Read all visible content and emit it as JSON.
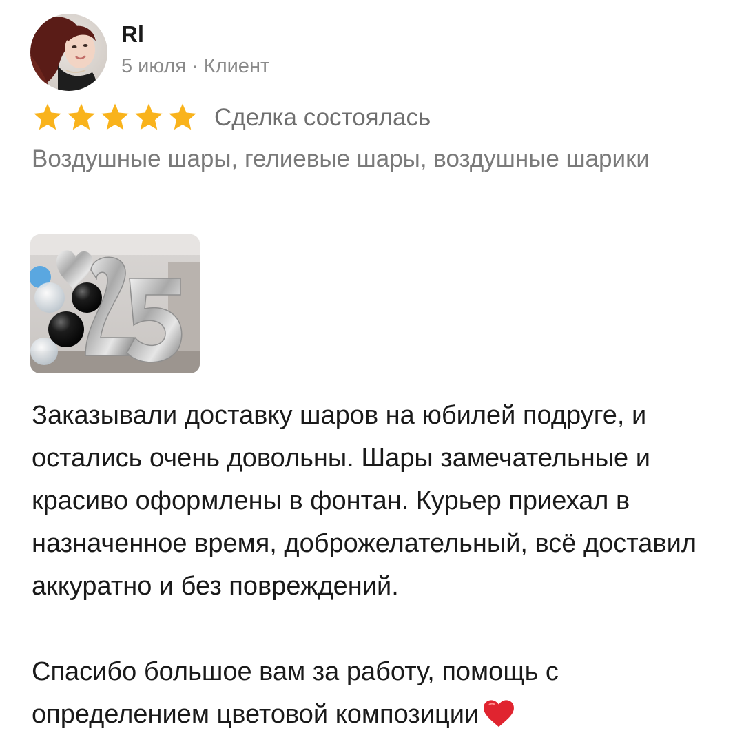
{
  "review": {
    "author": {
      "name": "Rl",
      "date": "5 июля",
      "separator": "·",
      "role": "Клиент"
    },
    "rating": {
      "stars": 5,
      "max": 5,
      "star_color": "#f9b31c"
    },
    "deal_status": "Сделка состоялась",
    "categories": "Воздушные шары, гелиевые шары, воздушные шарики",
    "photo_icon": "balloons-photo-25",
    "text_paragraph_1": "Заказывали доставку шаров на юбилей подруге, и остались очень довольны. Шары замечательные и красиво оформлены в фонтан. Курьер приехал в назначенное время, доброжелательный, всё доставил аккуратно и без повреждений.",
    "text_paragraph_2": "Спасибо большое вам за работу, помощь с определением цветовой композиции",
    "emoji": "heart-icon"
  }
}
